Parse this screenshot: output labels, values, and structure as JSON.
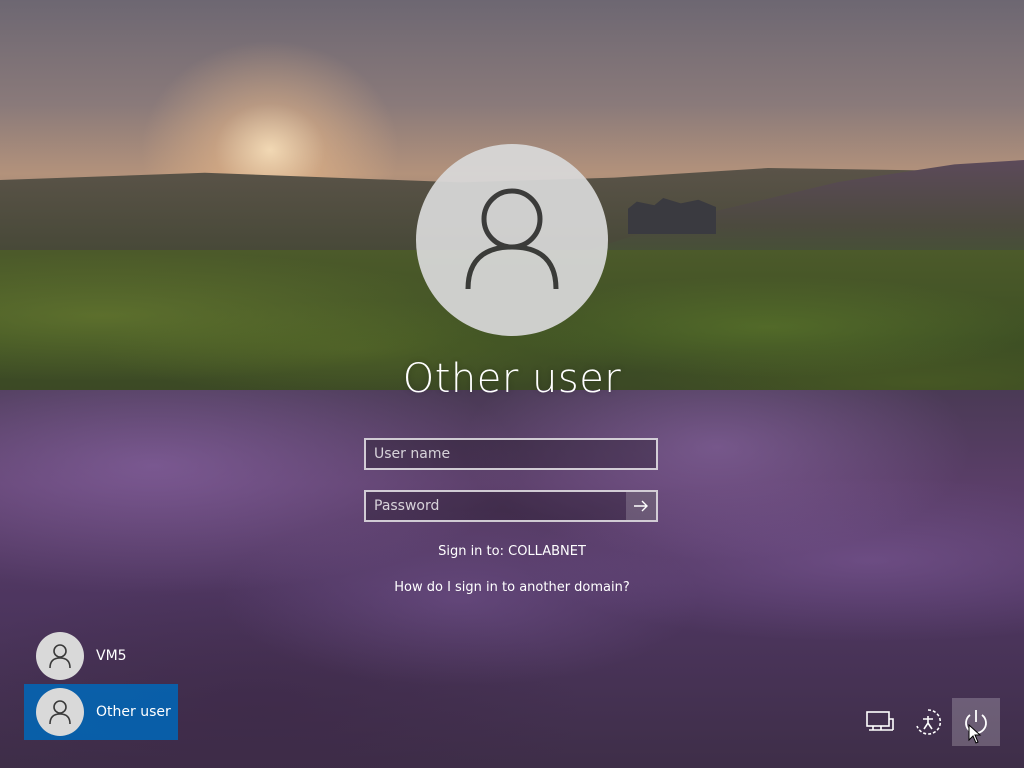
{
  "login": {
    "selected_user_title": "Other user",
    "username_placeholder": "User name",
    "password_placeholder": "Password",
    "sign_in_to": "Sign in to: COLLABNET",
    "domain_help_link": "How do I sign in to another domain?"
  },
  "user_list": {
    "users": [
      {
        "label": "VM5",
        "selected": false
      },
      {
        "label": "Other user",
        "selected": true
      }
    ]
  },
  "corner_controls": {
    "icons": [
      "network-icon",
      "ease-of-access-icon",
      "power-icon"
    ]
  },
  "colors": {
    "selected_user_bg": "#0067b8",
    "avatar_bg": "#d9d9d9",
    "text": "#ffffff"
  }
}
